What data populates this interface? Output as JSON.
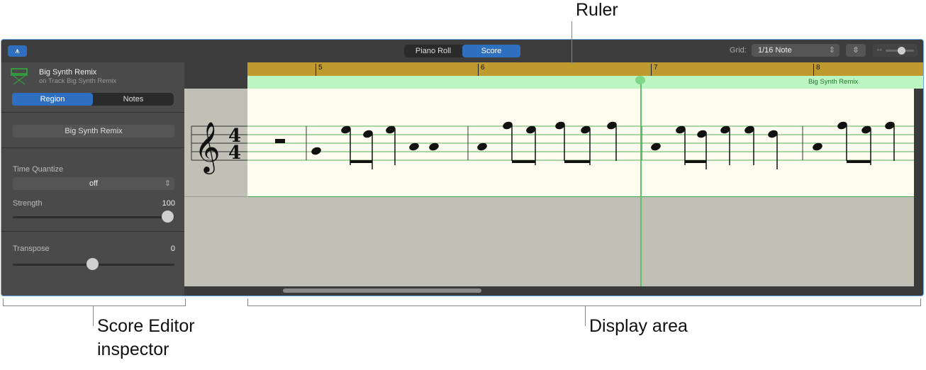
{
  "toolbar": {
    "view_tabs": [
      "Piano Roll",
      "Score"
    ],
    "active_tab": "Score",
    "grid_label": "Grid:",
    "grid_value": "1/16 Note"
  },
  "inspector": {
    "region_name": "Big Synth Remix",
    "track_line": "on Track Big Synth Remix",
    "tabs": [
      "Region",
      "Notes"
    ],
    "name_field": "Big Synth Remix",
    "time_quantize_label": "Time Quantize",
    "time_quantize_value": "off",
    "strength_label": "Strength",
    "strength_value": "100",
    "transpose_label": "Transpose",
    "transpose_value": "0"
  },
  "ruler": {
    "bars": [
      "5",
      "6",
      "7",
      "8"
    ],
    "region_label": "Big Synth Remix"
  },
  "score": {
    "time_signature": [
      "4",
      "4"
    ]
  },
  "callouts": {
    "ruler": "Ruler",
    "inspector_line1": "Score Editor",
    "inspector_line2": "inspector",
    "display": "Display area"
  }
}
